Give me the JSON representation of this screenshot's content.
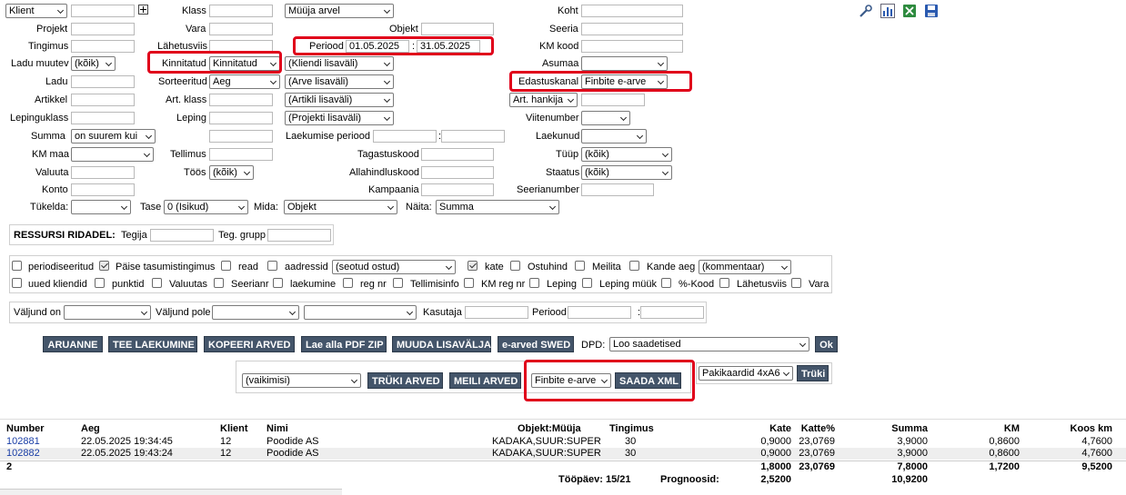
{
  "filters": {
    "klient_select": "Klient",
    "klass_label": "Klass",
    "klass_select": "Müüja arvel",
    "koht_label": "Koht",
    "projekt_label": "Projekt",
    "vara_label": "Vara",
    "objekt_label": "Objekt",
    "seeria_label": "Seeria",
    "tingimus_label": "Tingimus",
    "lahetusviis_label": "Lähetusviis",
    "periood_label": "Periood",
    "periood_from": "01.05.2025",
    "periood_sep": ":",
    "periood_to": "31.05.2025",
    "km_kood_label": "KM kood",
    "ladu_muutev_label": "Ladu muutev",
    "ladu_muutev_select": "(kõik)",
    "kinnitatud_label": "Kinnitatud",
    "kinnitatud_select": "Kinnitatud",
    "kliendi_lisavali": "(Kliendi lisaväli)",
    "asumaa_label": "Asumaa",
    "asumaa_select": "",
    "ladu_label": "Ladu",
    "sorteeritud_label": "Sorteeritud",
    "sorteeritud_select": "Aeg",
    "arve_lisavali": "(Arve lisaväli)",
    "edastuskanal_label": "Edastuskanal",
    "edastuskanal_select": "Finbite e-arve",
    "artikkel_label": "Artikkel",
    "art_klass_label": "Art. klass",
    "artikli_lisavali": "(Artikli lisaväli)",
    "art_hankija_select": "Art. hankija",
    "lepinguklass_label": "Lepinguklass",
    "leping_label": "Leping",
    "projekti_lisavali": "(Projekti lisaväli)",
    "viitenumber_label": "Viitenumber",
    "viitenumber_select": "",
    "summa_label": "Summa",
    "summa_select": "on suurem kui",
    "laekumise_periood_label": "Laekumise periood",
    "laekumise_sep": ":",
    "laekunud_label": "Laekunud",
    "laekunud_select": "",
    "km_maa_label": "KM maa",
    "km_maa_select": "",
    "tellimus_label": "Tellimus",
    "tagastuskood_label": "Tagastuskood",
    "tuup_label": "Tüüp",
    "tuup_select": "(kõik)",
    "valuuta_label": "Valuuta",
    "toos_label": "Töös",
    "toos_select": "(kõik)",
    "allahindluskood_label": "Allahindluskood",
    "staatus_label": "Staatus",
    "staatus_select": "(kõik)",
    "konto_label": "Konto",
    "kampaania_label": "Kampaania",
    "seerianumber_label": "Seerianumber",
    "tukelda_label": "Tükelda:",
    "tukelda_select": "",
    "tase_label": "Tase",
    "tase_select": "0 (Isikud)",
    "mida_label": "Mida:",
    "mida_select": "Objekt",
    "naita_label": "Näita:",
    "naita_select": "Summa"
  },
  "ressursi": {
    "title": "RESSURSI RIDADEL:",
    "tegija_label": "Tegija",
    "teg_grupp_label": "Teg. grupp"
  },
  "options_row1": {
    "periodiseeritud": "periodiseeritud",
    "paise": "Päise tasumistingimus",
    "read": "read",
    "aadressid": "aadressid",
    "seotud_ostud": "(seotud ostud)",
    "kate": "kate",
    "ostuhind": "Ostuhind",
    "meilita": "Meilita",
    "kande_aeg": "Kande aeg",
    "kommentaar": "(kommentaar)"
  },
  "options_row2": {
    "uued_kliendid": "uued kliendid",
    "punktid": "punktid",
    "valuutas": "Valuutas",
    "seerianr": "Seerianr",
    "laekumine": "laekumine",
    "reg_nr": "reg nr",
    "tellimisinfo": "Tellimisinfo",
    "km_reg_nr": "KM reg nr",
    "leping": "Leping",
    "leping_muuk": "Leping müük",
    "kood": "%-Kood",
    "lahetusviis": "Lähetusviis",
    "vara": "Vara"
  },
  "output": {
    "valjund_on_label": "Väljund on",
    "valjund_pole_label": "Väljund pole",
    "kasutaja_label": "Kasutaja",
    "periood_label": "Periood",
    "periood_sep": ":"
  },
  "actions": {
    "aruanne": "ARUANNE",
    "tee_laekumine": "TEE LAEKUMINE",
    "kopeeri_arved": "KOPEERI ARVED",
    "lae_alla_pdf_zip": "Lae alla PDF ZIP",
    "muuda_lisavalja": "MUUDA LISAVÄLJA",
    "e_arved_swed": "e-arved SWED",
    "dpd_label": "DPD:",
    "dpd_select": "Loo saadetised",
    "ok": "Ok",
    "vaikimisi_select": "(vaikimisi)",
    "truki_arved": "TRÜKI ARVED",
    "meili_arved": "MEILI ARVED",
    "finbite_select": "Finbite e-arve",
    "saada_xml": "SAADA XML",
    "pakikaardid_select": "Pakikaardid 4xA6",
    "truki": "Trüki"
  },
  "table": {
    "headers": {
      "number": "Number",
      "aeg": "Aeg",
      "klient": "Klient",
      "nimi": "Nimi",
      "objekt_muuja": "Objekt:Müüja",
      "tingimus": "Tingimus",
      "kate": "Kate",
      "katte_pct": "Katte%",
      "summa": "Summa",
      "km": "KM",
      "koos_km": "Koos km"
    },
    "rows": [
      {
        "number": "102881",
        "aeg": "22.05.2025 19:34:45",
        "klient": "12",
        "nimi": "Poodide AS",
        "objekt": "KADAKA,SUUR:SUPER",
        "tingimus": "30",
        "kate": "0,9000",
        "katte_pct": "23,0769",
        "summa": "3,9000",
        "km": "0,8600",
        "koos_km": "4,7600"
      },
      {
        "number": "102882",
        "aeg": "22.05.2025 19:43:24",
        "klient": "12",
        "nimi": "Poodide AS",
        "objekt": "KADAKA,SUUR:SUPER",
        "tingimus": "30",
        "kate": "0,9000",
        "katte_pct": "23,0769",
        "summa": "3,9000",
        "km": "0,8600",
        "koos_km": "4,7600"
      }
    ],
    "totals": {
      "count": "2",
      "kate": "1,8000",
      "katte_pct": "23,0769",
      "summa": "7,8000",
      "km": "1,7200",
      "koos_km": "9,5200"
    },
    "footer": {
      "toopaev_label": "Tööpäev: 15/21",
      "prognoosid_label": "Prognoosid:",
      "prognoosid_kate": "2,5200",
      "prognoosid_summa": "10,9200"
    }
  },
  "colors": {
    "button_bg": "#44556a",
    "highlight": "#e0001a",
    "link": "#1a3ea6"
  }
}
